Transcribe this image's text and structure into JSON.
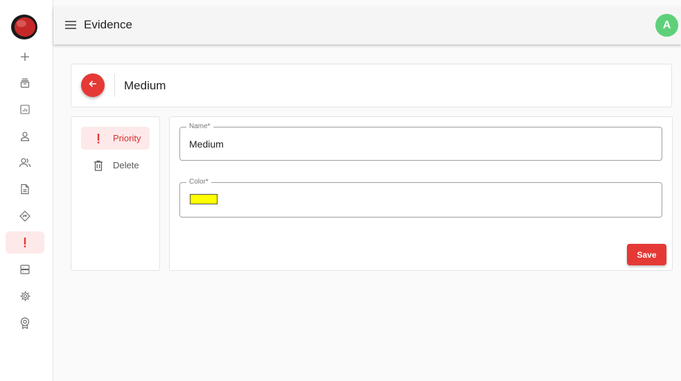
{
  "app": {
    "title": "Evidence",
    "avatar_initial": "A",
    "avatar_color": "#5fd07a",
    "accent_color": "#e53935"
  },
  "rail": {
    "items": [
      {
        "icon": "plus-icon"
      },
      {
        "icon": "archive-icon"
      },
      {
        "icon": "report-icon"
      },
      {
        "icon": "user-icon"
      },
      {
        "icon": "users-icon"
      },
      {
        "icon": "document-icon"
      },
      {
        "icon": "direction-sign-icon"
      },
      {
        "icon": "priority-icon",
        "active": true
      },
      {
        "icon": "server-icon"
      },
      {
        "icon": "settings-icon"
      },
      {
        "icon": "badge-icon"
      }
    ]
  },
  "header": {
    "title": "Medium"
  },
  "subnav": {
    "items": [
      {
        "label": "Priority",
        "icon": "exclamation-icon",
        "active": true
      },
      {
        "label": "Delete",
        "icon": "trash-icon"
      }
    ]
  },
  "form": {
    "name": {
      "label": "Name*",
      "value": "Medium"
    },
    "color": {
      "label": "Color*",
      "value": "#ffff00"
    },
    "save_label": "Save"
  }
}
